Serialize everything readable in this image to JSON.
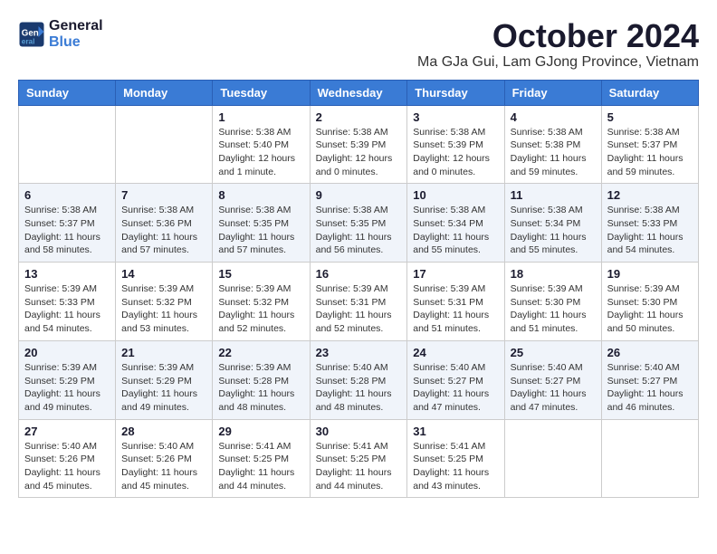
{
  "logo": {
    "line1": "General",
    "line2": "Blue"
  },
  "title": "October 2024",
  "location": "Ma GJa Gui, Lam GJong Province, Vietnam",
  "days_of_week": [
    "Sunday",
    "Monday",
    "Tuesday",
    "Wednesday",
    "Thursday",
    "Friday",
    "Saturday"
  ],
  "weeks": [
    [
      {
        "day": "",
        "sunrise": "",
        "sunset": "",
        "daylight": ""
      },
      {
        "day": "",
        "sunrise": "",
        "sunset": "",
        "daylight": ""
      },
      {
        "day": "1",
        "sunrise": "Sunrise: 5:38 AM",
        "sunset": "Sunset: 5:40 PM",
        "daylight": "Daylight: 12 hours and 1 minute."
      },
      {
        "day": "2",
        "sunrise": "Sunrise: 5:38 AM",
        "sunset": "Sunset: 5:39 PM",
        "daylight": "Daylight: 12 hours and 0 minutes."
      },
      {
        "day": "3",
        "sunrise": "Sunrise: 5:38 AM",
        "sunset": "Sunset: 5:39 PM",
        "daylight": "Daylight: 12 hours and 0 minutes."
      },
      {
        "day": "4",
        "sunrise": "Sunrise: 5:38 AM",
        "sunset": "Sunset: 5:38 PM",
        "daylight": "Daylight: 11 hours and 59 minutes."
      },
      {
        "day": "5",
        "sunrise": "Sunrise: 5:38 AM",
        "sunset": "Sunset: 5:37 PM",
        "daylight": "Daylight: 11 hours and 59 minutes."
      }
    ],
    [
      {
        "day": "6",
        "sunrise": "Sunrise: 5:38 AM",
        "sunset": "Sunset: 5:37 PM",
        "daylight": "Daylight: 11 hours and 58 minutes."
      },
      {
        "day": "7",
        "sunrise": "Sunrise: 5:38 AM",
        "sunset": "Sunset: 5:36 PM",
        "daylight": "Daylight: 11 hours and 57 minutes."
      },
      {
        "day": "8",
        "sunrise": "Sunrise: 5:38 AM",
        "sunset": "Sunset: 5:35 PM",
        "daylight": "Daylight: 11 hours and 57 minutes."
      },
      {
        "day": "9",
        "sunrise": "Sunrise: 5:38 AM",
        "sunset": "Sunset: 5:35 PM",
        "daylight": "Daylight: 11 hours and 56 minutes."
      },
      {
        "day": "10",
        "sunrise": "Sunrise: 5:38 AM",
        "sunset": "Sunset: 5:34 PM",
        "daylight": "Daylight: 11 hours and 55 minutes."
      },
      {
        "day": "11",
        "sunrise": "Sunrise: 5:38 AM",
        "sunset": "Sunset: 5:34 PM",
        "daylight": "Daylight: 11 hours and 55 minutes."
      },
      {
        "day": "12",
        "sunrise": "Sunrise: 5:38 AM",
        "sunset": "Sunset: 5:33 PM",
        "daylight": "Daylight: 11 hours and 54 minutes."
      }
    ],
    [
      {
        "day": "13",
        "sunrise": "Sunrise: 5:39 AM",
        "sunset": "Sunset: 5:33 PM",
        "daylight": "Daylight: 11 hours and 54 minutes."
      },
      {
        "day": "14",
        "sunrise": "Sunrise: 5:39 AM",
        "sunset": "Sunset: 5:32 PM",
        "daylight": "Daylight: 11 hours and 53 minutes."
      },
      {
        "day": "15",
        "sunrise": "Sunrise: 5:39 AM",
        "sunset": "Sunset: 5:32 PM",
        "daylight": "Daylight: 11 hours and 52 minutes."
      },
      {
        "day": "16",
        "sunrise": "Sunrise: 5:39 AM",
        "sunset": "Sunset: 5:31 PM",
        "daylight": "Daylight: 11 hours and 52 minutes."
      },
      {
        "day": "17",
        "sunrise": "Sunrise: 5:39 AM",
        "sunset": "Sunset: 5:31 PM",
        "daylight": "Daylight: 11 hours and 51 minutes."
      },
      {
        "day": "18",
        "sunrise": "Sunrise: 5:39 AM",
        "sunset": "Sunset: 5:30 PM",
        "daylight": "Daylight: 11 hours and 51 minutes."
      },
      {
        "day": "19",
        "sunrise": "Sunrise: 5:39 AM",
        "sunset": "Sunset: 5:30 PM",
        "daylight": "Daylight: 11 hours and 50 minutes."
      }
    ],
    [
      {
        "day": "20",
        "sunrise": "Sunrise: 5:39 AM",
        "sunset": "Sunset: 5:29 PM",
        "daylight": "Daylight: 11 hours and 49 minutes."
      },
      {
        "day": "21",
        "sunrise": "Sunrise: 5:39 AM",
        "sunset": "Sunset: 5:29 PM",
        "daylight": "Daylight: 11 hours and 49 minutes."
      },
      {
        "day": "22",
        "sunrise": "Sunrise: 5:39 AM",
        "sunset": "Sunset: 5:28 PM",
        "daylight": "Daylight: 11 hours and 48 minutes."
      },
      {
        "day": "23",
        "sunrise": "Sunrise: 5:40 AM",
        "sunset": "Sunset: 5:28 PM",
        "daylight": "Daylight: 11 hours and 48 minutes."
      },
      {
        "day": "24",
        "sunrise": "Sunrise: 5:40 AM",
        "sunset": "Sunset: 5:27 PM",
        "daylight": "Daylight: 11 hours and 47 minutes."
      },
      {
        "day": "25",
        "sunrise": "Sunrise: 5:40 AM",
        "sunset": "Sunset: 5:27 PM",
        "daylight": "Daylight: 11 hours and 47 minutes."
      },
      {
        "day": "26",
        "sunrise": "Sunrise: 5:40 AM",
        "sunset": "Sunset: 5:27 PM",
        "daylight": "Daylight: 11 hours and 46 minutes."
      }
    ],
    [
      {
        "day": "27",
        "sunrise": "Sunrise: 5:40 AM",
        "sunset": "Sunset: 5:26 PM",
        "daylight": "Daylight: 11 hours and 45 minutes."
      },
      {
        "day": "28",
        "sunrise": "Sunrise: 5:40 AM",
        "sunset": "Sunset: 5:26 PM",
        "daylight": "Daylight: 11 hours and 45 minutes."
      },
      {
        "day": "29",
        "sunrise": "Sunrise: 5:41 AM",
        "sunset": "Sunset: 5:25 PM",
        "daylight": "Daylight: 11 hours and 44 minutes."
      },
      {
        "day": "30",
        "sunrise": "Sunrise: 5:41 AM",
        "sunset": "Sunset: 5:25 PM",
        "daylight": "Daylight: 11 hours and 44 minutes."
      },
      {
        "day": "31",
        "sunrise": "Sunrise: 5:41 AM",
        "sunset": "Sunset: 5:25 PM",
        "daylight": "Daylight: 11 hours and 43 minutes."
      },
      {
        "day": "",
        "sunrise": "",
        "sunset": "",
        "daylight": ""
      },
      {
        "day": "",
        "sunrise": "",
        "sunset": "",
        "daylight": ""
      }
    ]
  ]
}
